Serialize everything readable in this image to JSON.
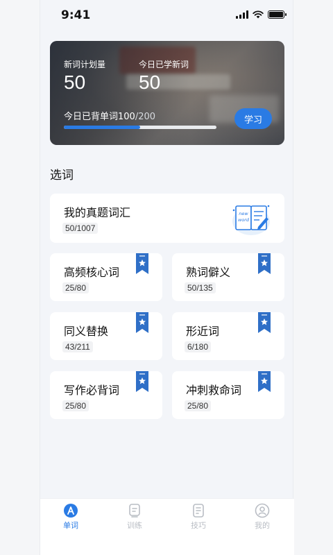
{
  "status": {
    "time": "9:41"
  },
  "hero": {
    "plan_label": "新词计划量",
    "plan_value": "50",
    "today_label": "今日已学新词",
    "today_value": "50",
    "progress_prefix": "今日已背单词",
    "progress_done": "100",
    "progress_total": "/200",
    "progress_fraction": 0.5,
    "study_button": "学习"
  },
  "section_title": "选词",
  "cards": [
    {
      "title": "我的真题词汇",
      "count": "50/1007"
    },
    {
      "title": "高频核心词",
      "count": "25/80"
    },
    {
      "title": "熟词僻义",
      "count": "50/135"
    },
    {
      "title": "同义替换",
      "count": "43/211"
    },
    {
      "title": "形近词",
      "count": "6/180"
    },
    {
      "title": "写作必背词",
      "count": "25/80"
    },
    {
      "title": "冲刺救命词",
      "count": "25/80"
    }
  ],
  "illustration": {
    "line1": "new",
    "line2": "word"
  },
  "tabs": [
    {
      "label": "单词",
      "icon": "letter-a-icon",
      "active": true
    },
    {
      "label": "训练",
      "icon": "training-icon",
      "active": false
    },
    {
      "label": "技巧",
      "icon": "tips-icon",
      "active": false
    },
    {
      "label": "我的",
      "icon": "profile-icon",
      "active": false
    }
  ],
  "colors": {
    "accent": "#2a7be4",
    "ribbon": "#2f6fc7",
    "background": "#f3f5f9"
  }
}
